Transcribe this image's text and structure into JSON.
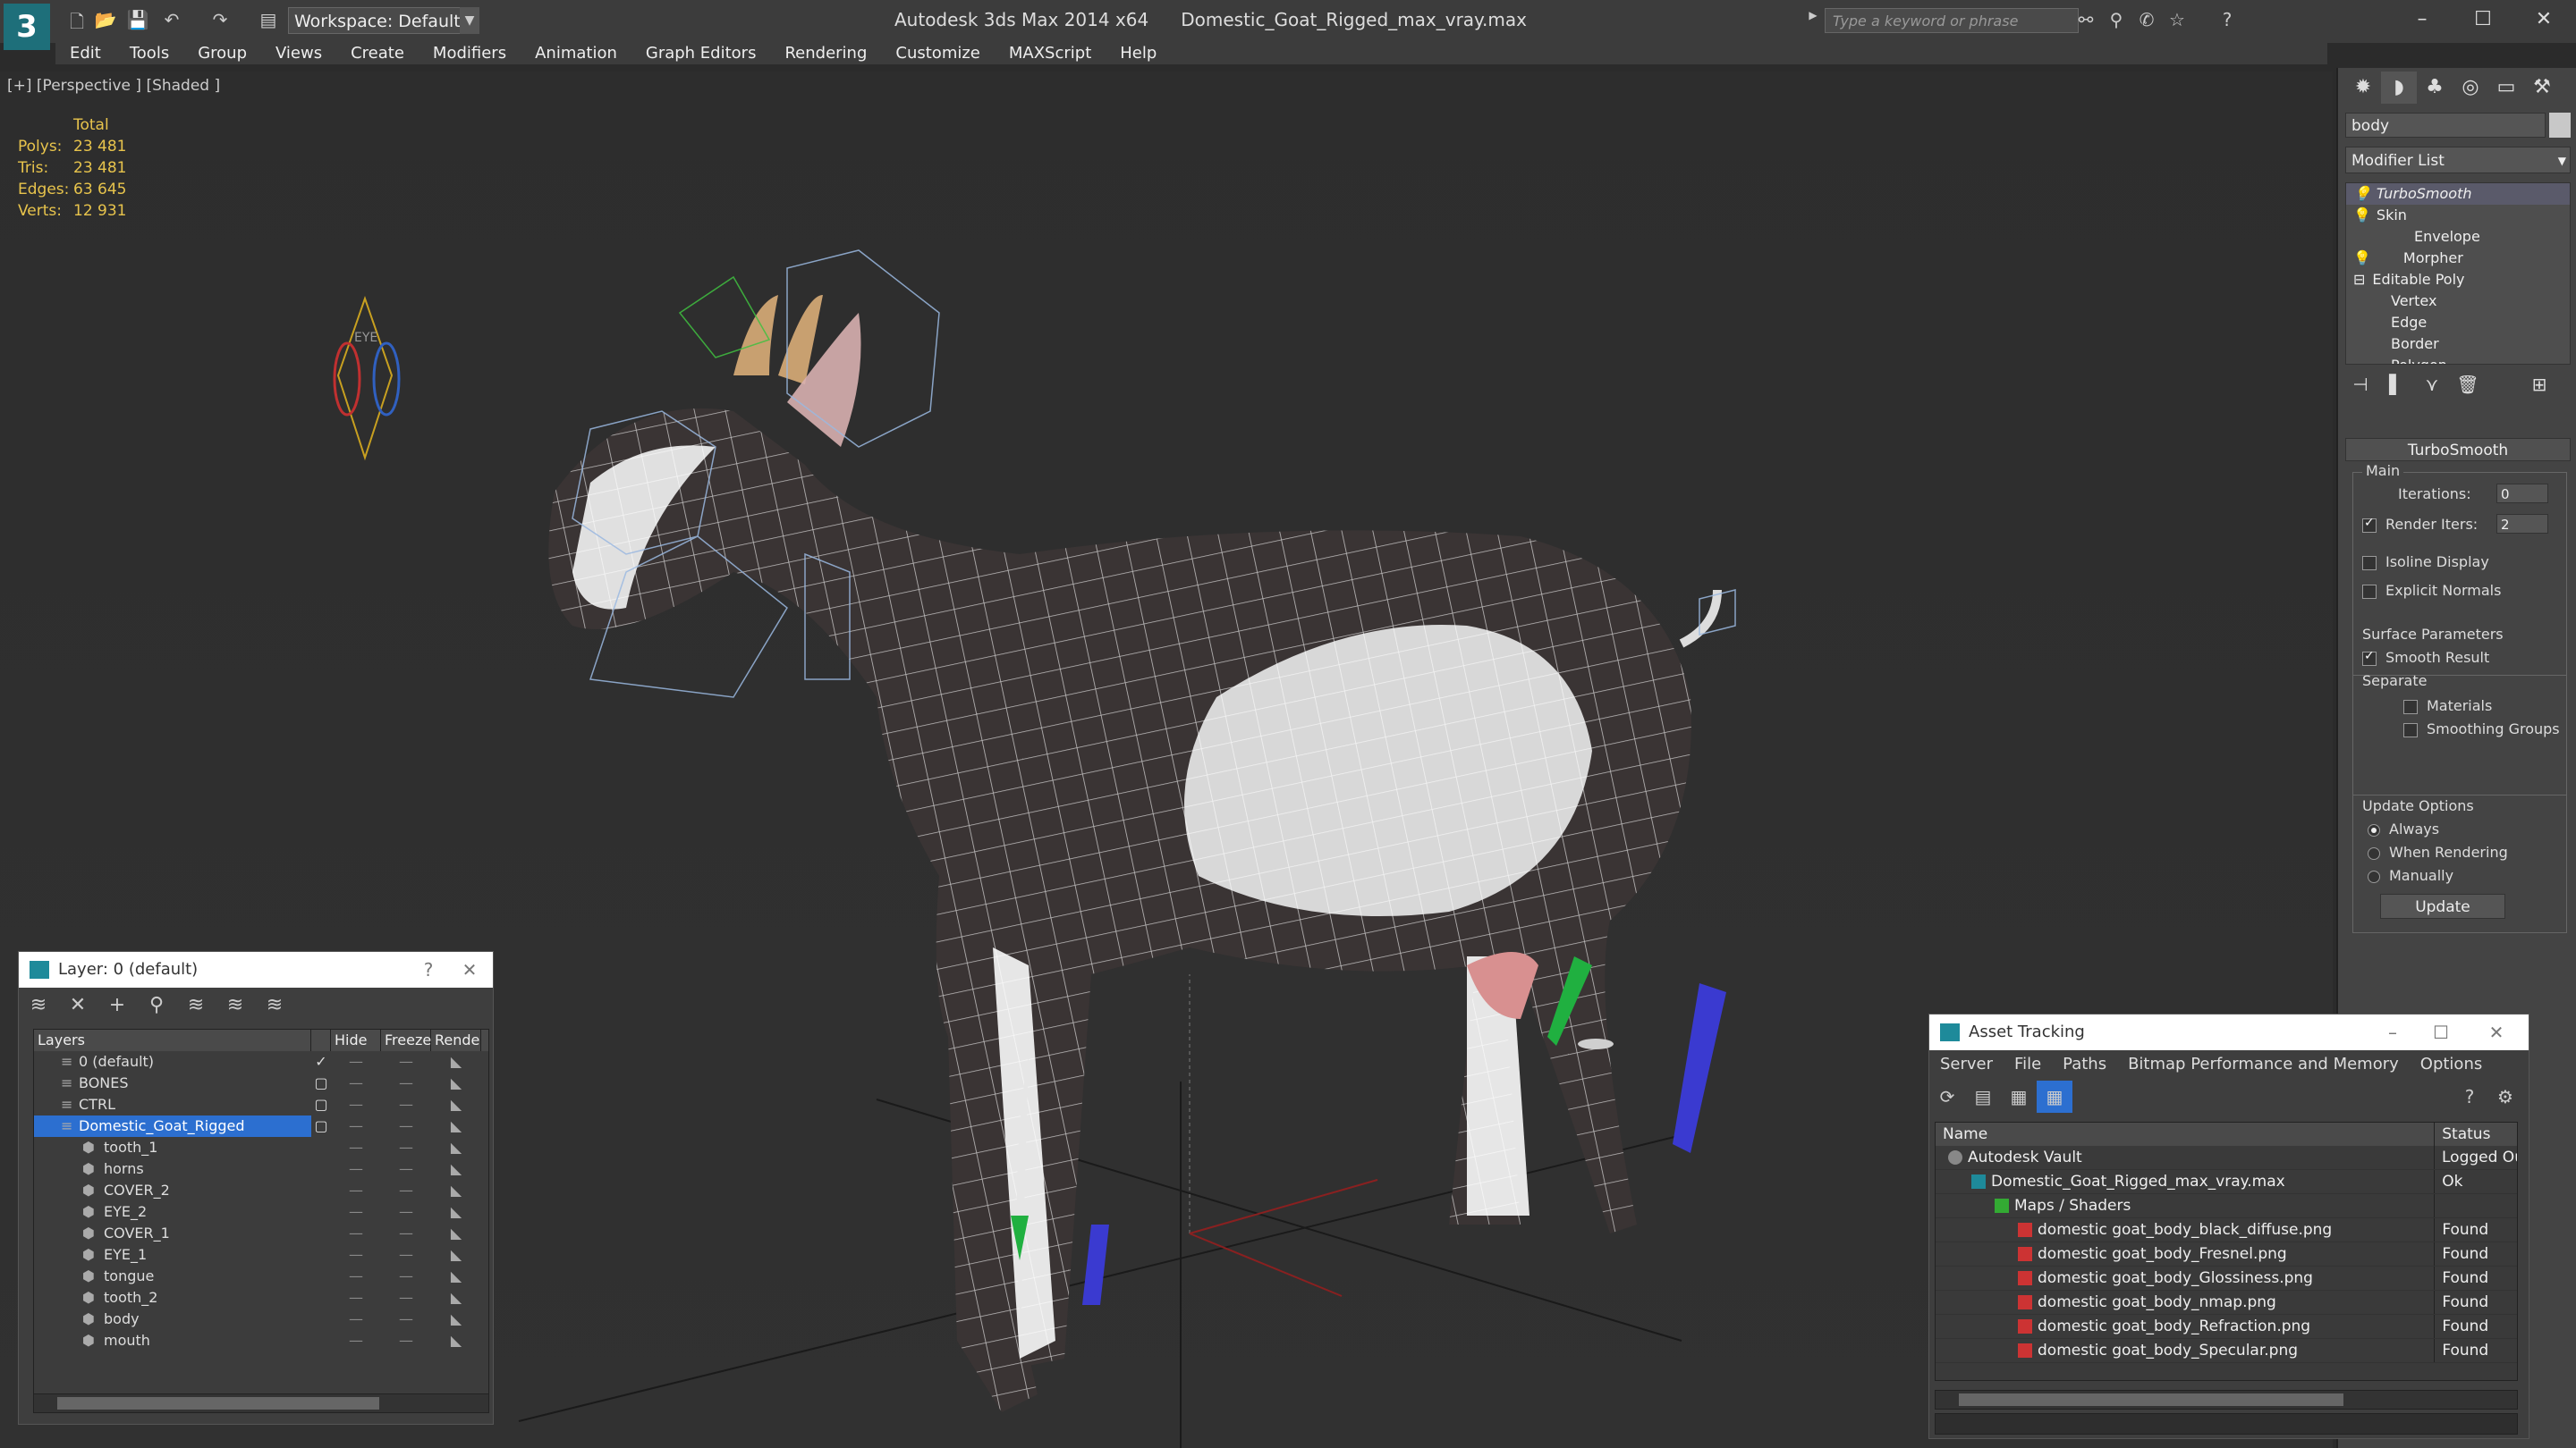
{
  "titlebar": {
    "app": "Autodesk 3ds Max  2014 x64",
    "file": "Domestic_Goat_Rigged_max_vray.max",
    "workspace": "Workspace: Default",
    "search_placeholder": "Type a keyword or phrase"
  },
  "menu": [
    "Edit",
    "Tools",
    "Group",
    "Views",
    "Create",
    "Modifiers",
    "Animation",
    "Graph Editors",
    "Rendering",
    "Customize",
    "MAXScript",
    "Help"
  ],
  "viewport": {
    "label": "[+] [Perspective ] [Shaded ]",
    "stats": {
      "total_label": "Total",
      "rows": [
        {
          "k": "Polys:",
          "v": "23 481"
        },
        {
          "k": "Tris:",
          "v": "23 481"
        },
        {
          "k": "Edges:",
          "v": "63 645"
        },
        {
          "k": "Verts:",
          "v": "12 931"
        }
      ]
    },
    "eye_label": "EYE"
  },
  "command_panel": {
    "object_name": "body",
    "modifier_list": "Modifier List",
    "stack": [
      "TurboSmooth",
      "Skin",
      "Envelope",
      "Morpher",
      "Editable Poly",
      "Vertex",
      "Edge",
      "Border",
      "Polygon"
    ],
    "rollout": "TurboSmooth",
    "main_label": "Main",
    "iterations_label": "Iterations:",
    "iterations": "0",
    "render_iters_label": "Render Iters:",
    "render_iters": "2",
    "isoline": "Isoline Display",
    "explicit_normals": "Explicit Normals",
    "surface_params": "Surface Parameters",
    "smooth_result": "Smooth Result",
    "separate": "Separate",
    "materials": "Materials",
    "smoothing_groups": "Smoothing Groups",
    "update_options": "Update Options",
    "always": "Always",
    "when_rendering": "When Rendering",
    "manually": "Manually",
    "update": "Update"
  },
  "layer_window": {
    "title": "Layer: 0 (default)",
    "help": "?",
    "columns": [
      "Layers",
      "Hide",
      "Freeze",
      "Rende"
    ],
    "rows": [
      {
        "name": "0 (default)",
        "child": false,
        "selected": false,
        "current": "✓"
      },
      {
        "name": "BONES",
        "child": false,
        "selected": false,
        "current": "▢"
      },
      {
        "name": "CTRL",
        "child": false,
        "selected": false,
        "current": "▢"
      },
      {
        "name": "Domestic_Goat_Rigged",
        "child": false,
        "selected": true,
        "current": "▢"
      },
      {
        "name": "tooth_1",
        "child": true,
        "selected": false,
        "current": ""
      },
      {
        "name": "horns",
        "child": true,
        "selected": false,
        "current": ""
      },
      {
        "name": "COVER_2",
        "child": true,
        "selected": false,
        "current": ""
      },
      {
        "name": "EYE_2",
        "child": true,
        "selected": false,
        "current": ""
      },
      {
        "name": "COVER_1",
        "child": true,
        "selected": false,
        "current": ""
      },
      {
        "name": "EYE_1",
        "child": true,
        "selected": false,
        "current": ""
      },
      {
        "name": "tongue",
        "child": true,
        "selected": false,
        "current": ""
      },
      {
        "name": "tooth_2",
        "child": true,
        "selected": false,
        "current": ""
      },
      {
        "name": "body",
        "child": true,
        "selected": false,
        "current": ""
      },
      {
        "name": "mouth",
        "child": true,
        "selected": false,
        "current": ""
      }
    ]
  },
  "asset_window": {
    "title": "Asset Tracking",
    "menu": [
      "Server",
      "File",
      "Paths",
      "Bitmap Performance and Memory",
      "Options"
    ],
    "columns": [
      "Name",
      "Status"
    ],
    "rows": [
      {
        "name": "Autodesk Vault",
        "status": "Logged Out",
        "indent": 0,
        "icon": "vault"
      },
      {
        "name": "Domestic_Goat_Rigged_max_vray.max",
        "status": "Ok",
        "indent": 1,
        "icon": "max"
      },
      {
        "name": "Maps / Shaders",
        "status": "",
        "indent": 2,
        "icon": "folder"
      },
      {
        "name": "domestic goat_body_black_diffuse.png",
        "status": "Found",
        "indent": 3,
        "icon": "png"
      },
      {
        "name": "domestic goat_body_Fresnel.png",
        "status": "Found",
        "indent": 3,
        "icon": "png"
      },
      {
        "name": "domestic goat_body_Glossiness.png",
        "status": "Found",
        "indent": 3,
        "icon": "png"
      },
      {
        "name": "domestic goat_body_nmap.png",
        "status": "Found",
        "indent": 3,
        "icon": "png"
      },
      {
        "name": "domestic goat_body_Refraction.png",
        "status": "Found",
        "indent": 3,
        "icon": "png"
      },
      {
        "name": "domestic goat_body_Specular.png",
        "status": "Found",
        "indent": 3,
        "icon": "png"
      }
    ]
  }
}
